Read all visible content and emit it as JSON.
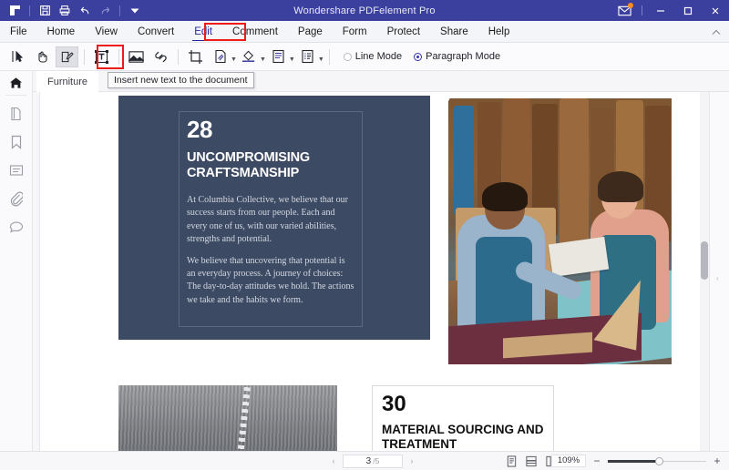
{
  "titlebar": {
    "title": "Wondershare PDFelement Pro",
    "quick_access": [
      {
        "name": "app-logo-icon",
        "label": "PDFelement"
      },
      {
        "name": "save-icon",
        "label": "Save"
      },
      {
        "name": "print-icon",
        "label": "Print"
      },
      {
        "name": "undo-icon",
        "label": "Undo"
      },
      {
        "name": "redo-icon",
        "label": "Redo"
      },
      {
        "name": "customize-chevron-icon",
        "label": "Customize Quick Access Toolbar"
      }
    ],
    "window_controls": {
      "mail": "Messages",
      "minimize": "—",
      "maximize": "□",
      "close": "✕"
    },
    "accent_bg": "#3b3f9e",
    "notification_dot": "#ff8a1e"
  },
  "menubar": {
    "items": [
      {
        "label": "File",
        "active": false
      },
      {
        "label": "Home",
        "active": false
      },
      {
        "label": "View",
        "active": false
      },
      {
        "label": "Convert",
        "active": false
      },
      {
        "label": "Edit",
        "active": true
      },
      {
        "label": "Comment",
        "active": false
      },
      {
        "label": "Page",
        "active": false
      },
      {
        "label": "Form",
        "active": false
      },
      {
        "label": "Protect",
        "active": false
      },
      {
        "label": "Share",
        "active": false
      },
      {
        "label": "Help",
        "active": false
      }
    ],
    "highlight_color": "#ee1b1b",
    "collapse_ribbon": "∧"
  },
  "toolbar": {
    "buttons": [
      {
        "name": "select-tool",
        "label": "Select"
      },
      {
        "name": "hand-tool",
        "label": "Hand"
      },
      {
        "name": "edit-text-tool",
        "label": "Edit"
      },
      {
        "name": "add-text-tool",
        "label": "Add Text"
      },
      {
        "name": "add-image-tool",
        "label": "Add Image"
      },
      {
        "name": "add-link-tool",
        "label": "Link"
      },
      {
        "name": "crop-tool",
        "label": "Crop"
      },
      {
        "name": "watermark-tool",
        "label": "Watermark"
      },
      {
        "name": "background-tool",
        "label": "Background"
      },
      {
        "name": "header-footer-tool",
        "label": "Header & Footer"
      },
      {
        "name": "bates-numbering-tool",
        "label": "Bates Numbering"
      }
    ],
    "modes": [
      {
        "label": "Line Mode",
        "selected": false
      },
      {
        "label": "Paragraph Mode",
        "selected": true
      }
    ],
    "highlight_color": "#ee1b1b"
  },
  "tooltip": {
    "text": "Insert new text to the document"
  },
  "sidebar": {
    "items": [
      {
        "name": "home-icon",
        "label": "Home"
      },
      {
        "name": "thumbnails-icon",
        "label": "Pages"
      },
      {
        "name": "bookmarks-icon",
        "label": "Bookmarks"
      },
      {
        "name": "comments-list-icon",
        "label": "Annotations"
      },
      {
        "name": "attachments-icon",
        "label": "Attachments"
      },
      {
        "name": "search-comment-icon",
        "label": "Comments"
      }
    ],
    "expand_arrow": "›"
  },
  "tabs": {
    "documents": [
      {
        "label": "Furniture",
        "active": true
      }
    ]
  },
  "document": {
    "page3": {
      "number": "28",
      "heading": "UNCOMPROMISING CRAFTSMANSHIP",
      "paragraphs": [
        "At Columbia Collective, we believe that our success starts from our people. Each and every one of us, with our varied abilities, strengths and potential.",
        "We believe that uncovering that potential is an everyday process. A journey of choices: The day-to-day attitudes we hold. The actions we take and the habits we form."
      ],
      "bg_color": "#3d4a63",
      "photo_caption": "Two craftspeople working with leather in a workshop"
    },
    "page4": {
      "number": "30",
      "heading": "MATERIAL SOURCING AND TREATMENT",
      "photo_caption": "Close-up of stitched grey fabric"
    }
  },
  "statusbar": {
    "prev_arrow": "‹",
    "next_arrow": "›",
    "current_page": "3",
    "total_pages": "/5",
    "view_modes": [
      {
        "name": "single-page-view-icon",
        "label": "Single Page"
      },
      {
        "name": "continuous-scroll-view-icon",
        "label": "Continuous"
      },
      {
        "name": "two-page-view-icon",
        "label": "Facing"
      },
      {
        "name": "thumbnail-grid-view-icon",
        "label": "Thumbnails"
      }
    ],
    "zoom_level": "109%",
    "zoom_out": "−",
    "zoom_in": "+"
  }
}
